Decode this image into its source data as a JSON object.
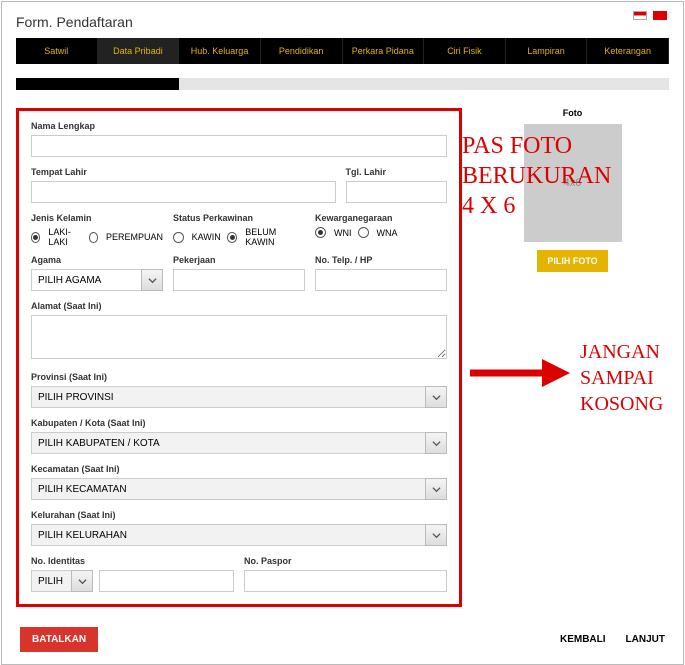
{
  "pageTitle": "Form. Pendaftaran",
  "tabs": [
    "Satwil",
    "Data Pribadi",
    "Hub. Keluarga",
    "Pendidikan",
    "Perkara Pidana",
    "Ciri Fisik",
    "Lampiran",
    "Keterangan"
  ],
  "labels": {
    "nama": "Nama Lengkap",
    "tempat": "Tempat Lahir",
    "tgl": "Tgl. Lahir",
    "jk": "Jenis Kelamin",
    "status": "Status Perkawinan",
    "kwn": "Kewarganegaraan",
    "agama": "Agama",
    "pekerjaan": "Pekerjaan",
    "telp": "No. Telp. / HP",
    "alamat": "Alamat (Saat Ini)",
    "prov": "Provinsi (Saat Ini)",
    "kab": "Kabupaten / Kota (Saat Ini)",
    "kec": "Kecamatan (Saat Ini)",
    "kel": "Kelurahan (Saat Ini)",
    "noid": "No. Identitas",
    "paspor": "No. Paspor",
    "foto": "Foto"
  },
  "radios": {
    "jk": [
      "LAKI-LAKI",
      "PEREMPUAN"
    ],
    "status": [
      "KAWIN",
      "BELUM KAWIN"
    ],
    "kwn": [
      "WNI",
      "WNA"
    ]
  },
  "placeholders": {
    "agama": "PILIH AGAMA",
    "prov": "PILIH PROVINSI",
    "kab": "PILIH KABUPATEN / KOTA",
    "kec": "PILIH KECAMATAN",
    "kel": "PILIH KELURAHAN",
    "idtype": "PILIH",
    "foto": "4x6"
  },
  "buttons": {
    "foto": "PILIH FOTO",
    "cancel": "BATALKAN",
    "back": "KEMBALI",
    "next": "LANJUT"
  },
  "overlay": {
    "l1": "PAS FOTO",
    "l2": "BERUKURAN",
    "l3": "4 X 6",
    "w1": "JANGAN",
    "w2": "SAMPAI",
    "w3": "KOSONG"
  }
}
